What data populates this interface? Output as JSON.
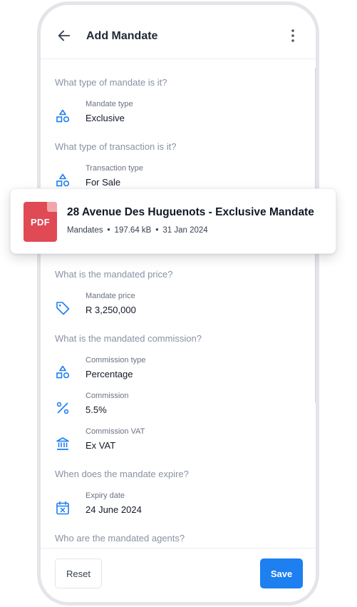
{
  "header": {
    "title": "Add Mandate"
  },
  "questions": {
    "mandate_type": "What type of mandate is it?",
    "transaction_type": "What type of transaction is it?",
    "price": "What is the mandated price?",
    "commission": "What is the mandated commission?",
    "expiry": "When does the mandate expire?",
    "agents": "Who are the mandated agents?"
  },
  "fields": {
    "mandate_type": {
      "label": "Mandate type",
      "value": "Exclusive",
      "icon": "shapes-icon"
    },
    "transaction_type": {
      "label": "Transaction type",
      "value": "For Sale",
      "icon": "shapes-icon"
    },
    "mandate_price": {
      "label": "Mandate price",
      "value": "R 3,250,000",
      "icon": "tag-icon"
    },
    "commission_type": {
      "label": "Commission type",
      "value": "Percentage",
      "icon": "shapes-icon"
    },
    "commission": {
      "label": "Commission",
      "value": "5.5%",
      "icon": "percent-icon"
    },
    "commission_vat": {
      "label": "Commission VAT",
      "value": "Ex VAT",
      "icon": "bank-icon"
    },
    "expiry_date": {
      "label": "Expiry date",
      "value": "24 June 2024",
      "icon": "calendar-icon"
    }
  },
  "document": {
    "type_label": "PDF",
    "title": "28 Avenue Des Huguenots - Exclusive Mandate",
    "category": "Mandates",
    "size": "197.64 kB",
    "date": "31 Jan 2024"
  },
  "footer": {
    "reset_label": "Reset",
    "save_label": "Save"
  },
  "colors": {
    "accent": "#1d7ff0",
    "pdf_red": "#e04a55",
    "question_gray": "#8892a2"
  }
}
